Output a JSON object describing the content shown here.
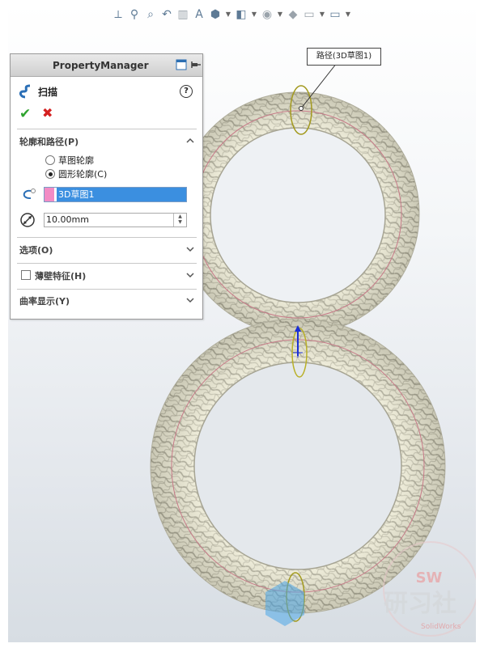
{
  "toolbar": {
    "icons": [
      "view-orientation-icon",
      "zoom-to-fit-icon",
      "zoom-area-icon",
      "previous-view-icon",
      "section-view-icon",
      "dynamic-annotation-icon",
      "view-cube-icon",
      "display-style-icon",
      "hide-show-icon",
      "edit-appearance-icon",
      "apply-scene-icon",
      "view-settings-icon"
    ]
  },
  "property_manager": {
    "title": "PropertyManager",
    "feature_name": "扫描",
    "help": "?",
    "sections": {
      "profile_path": {
        "title": "轮廓和路径(P)",
        "options": [
          {
            "label": "草图轮廓",
            "selected": false
          },
          {
            "label": "圆形轮廓(C)",
            "selected": true
          }
        ],
        "path_value": "3D草图1",
        "diameter_value": "10.00mm"
      },
      "options_title": "选项(O)",
      "thin_feature_title": "薄壁特征(H)",
      "curvature_title": "曲率显示(Y)"
    }
  },
  "graphics": {
    "callout_label": "路径(3D草图1)"
  },
  "watermark": {
    "sw": "SW",
    "brand": "研习社",
    "sub": "SolidWorks"
  },
  "colors": {
    "accent_blue": "#3b8fe0",
    "ok_green": "#2fa32f",
    "cancel_red": "#d42020",
    "profile_pink": "#f28cc5",
    "torus_base": "#e8e6d2"
  }
}
